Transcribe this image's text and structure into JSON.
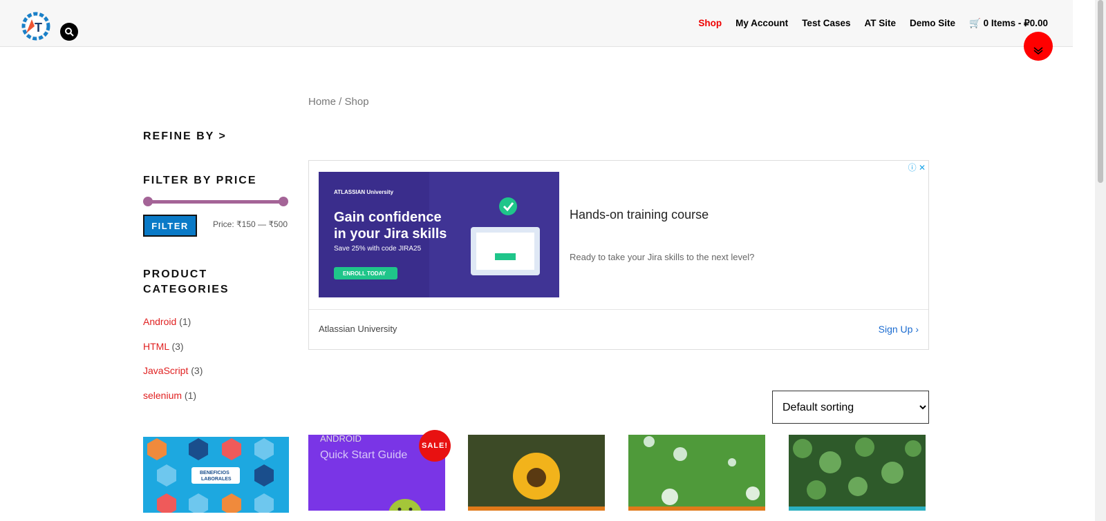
{
  "header": {
    "nav": [
      {
        "label": "Shop",
        "active": true
      },
      {
        "label": "My Account",
        "active": false
      },
      {
        "label": "Test Cases",
        "active": false
      },
      {
        "label": "AT Site",
        "active": false
      },
      {
        "label": "Demo Site",
        "active": false
      }
    ],
    "cart": "0 Items - ₽0.00",
    "logo_letters": "AT"
  },
  "breadcrumb": "Home / Shop",
  "sidebar": {
    "refine_heading": "REFINE BY >",
    "filter_heading": "FILTER BY PRICE",
    "filter_button": "FILTER",
    "price_label": "Price: ₹150 — ₹500",
    "categories_heading_1": "PRODUCT",
    "categories_heading_2": "CATEGORIES",
    "categories": [
      {
        "name": "Android",
        "count": "(1)"
      },
      {
        "name": "HTML",
        "count": "(3)"
      },
      {
        "name": "JavaScript",
        "count": "(3)"
      },
      {
        "name": "selenium",
        "count": "(1)"
      }
    ]
  },
  "ad": {
    "brand_small": "ATLASSIAN University",
    "headline_1": "Gain confidence",
    "headline_2": "in your Jira skills",
    "promo": "Save 25% with code JIRA25",
    "cta": "ENROLL TODAY",
    "title": "Hands-on training course",
    "description": "Ready to take your Jira skills to the next level?",
    "company": "Atlassian University",
    "signup": "Sign Up"
  },
  "sort": {
    "selected": "Default sorting"
  },
  "side_ad": {
    "text_1": "BENEFICIOS",
    "text_2": "LABORALES"
  },
  "products": [
    {
      "sale_badge": "SALE!",
      "cover_line_1": "ANDROID",
      "cover_line_2": "Quick Start Guide"
    }
  ],
  "colors": {
    "accent": "#e00000",
    "filter_button": "#0a7ac7",
    "slider": "#a46497",
    "link": "#e02020"
  }
}
